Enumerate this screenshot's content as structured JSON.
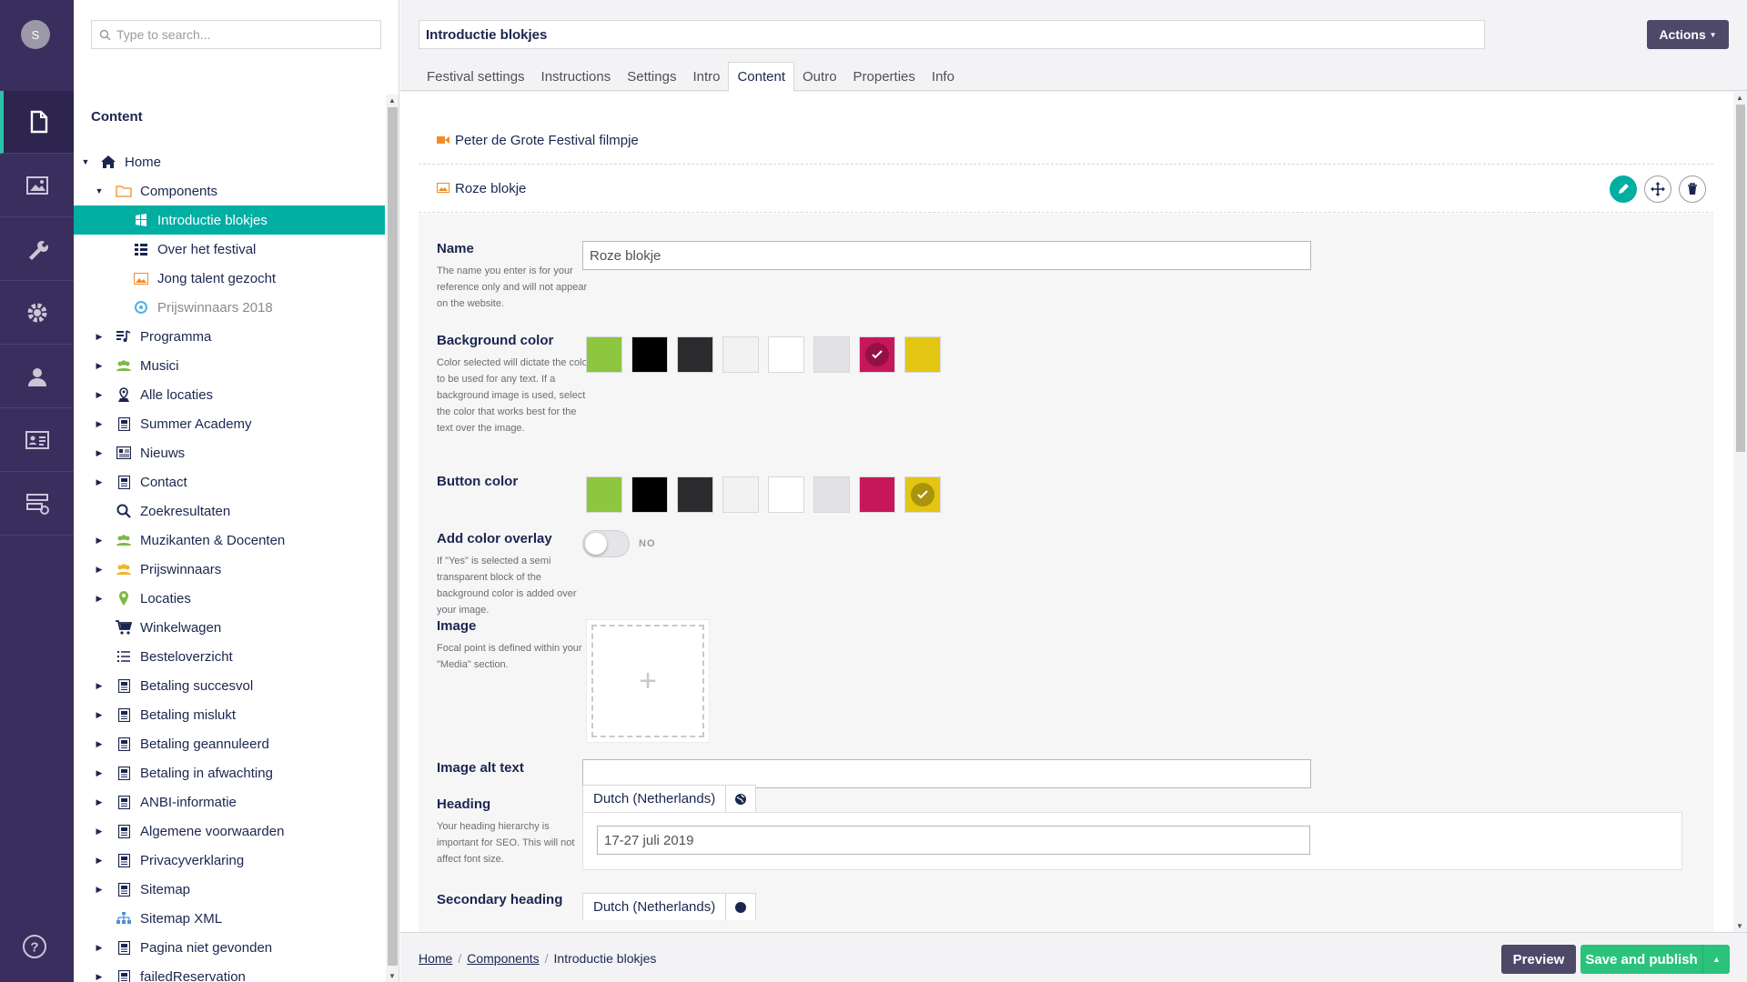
{
  "user": {
    "initial": "S"
  },
  "sections": [
    {
      "name": "content",
      "icon": "document-icon",
      "active": true
    },
    {
      "name": "media",
      "icon": "image-icon"
    },
    {
      "name": "settings",
      "icon": "wrench-icon"
    },
    {
      "name": "packages",
      "icon": "gear-icon"
    },
    {
      "name": "users",
      "icon": "user-icon"
    },
    {
      "name": "members",
      "icon": "id-card-icon"
    },
    {
      "name": "forms",
      "icon": "forms-icon"
    }
  ],
  "tree": {
    "search_placeholder": "Type to search...",
    "title": "Content",
    "items": [
      {
        "label": "Home",
        "level": 0,
        "caret": "down",
        "icon": "home-icon"
      },
      {
        "label": "Components",
        "level": 1,
        "caret": "down",
        "icon": "folder-icon"
      },
      {
        "label": "Introductie blokjes",
        "level": 2,
        "icon": "blocks-icon",
        "selected": true
      },
      {
        "label": "Over het festival",
        "level": 2,
        "icon": "grid-list-icon"
      },
      {
        "label": "Jong talent gezocht",
        "level": 2,
        "icon": "picture-icon"
      },
      {
        "label": "Prijswinnaars 2018",
        "level": 2,
        "icon": "target-icon",
        "muted": true
      },
      {
        "label": "Programma",
        "level": 1,
        "caret": "right",
        "icon": "music-list-icon"
      },
      {
        "label": "Musici",
        "level": 1,
        "caret": "right",
        "icon": "people-icon"
      },
      {
        "label": "Alle locaties",
        "level": 1,
        "caret": "right",
        "icon": "map-user-icon"
      },
      {
        "label": "Summer Academy",
        "level": 1,
        "caret": "right",
        "icon": "page-icon"
      },
      {
        "label": "Nieuws",
        "level": 1,
        "caret": "right",
        "icon": "newspaper-icon"
      },
      {
        "label": "Contact",
        "level": 1,
        "caret": "right",
        "icon": "page-icon"
      },
      {
        "label": "Zoekresultaten",
        "level": 1,
        "icon": "search-icon"
      },
      {
        "label": "Muzikanten & Docenten",
        "level": 1,
        "caret": "right",
        "icon": "people-icon"
      },
      {
        "label": "Prijswinnaars",
        "level": 1,
        "caret": "right",
        "icon": "people-gold-icon"
      },
      {
        "label": "Locaties",
        "level": 1,
        "caret": "right",
        "icon": "map-pin-icon"
      },
      {
        "label": "Winkelwagen",
        "level": 1,
        "icon": "cart-icon"
      },
      {
        "label": "Besteloverzicht",
        "level": 1,
        "icon": "list-icon"
      },
      {
        "label": "Betaling succesvol",
        "level": 1,
        "caret": "right",
        "icon": "page-icon"
      },
      {
        "label": "Betaling mislukt",
        "level": 1,
        "caret": "right",
        "icon": "page-icon"
      },
      {
        "label": "Betaling geannuleerd",
        "level": 1,
        "caret": "right",
        "icon": "page-icon"
      },
      {
        "label": "Betaling in afwachting",
        "level": 1,
        "caret": "right",
        "icon": "page-icon"
      },
      {
        "label": "ANBI-informatie",
        "level": 1,
        "caret": "right",
        "icon": "page-icon"
      },
      {
        "label": "Algemene voorwaarden",
        "level": 1,
        "caret": "right",
        "icon": "page-icon"
      },
      {
        "label": "Privacyverklaring",
        "level": 1,
        "caret": "right",
        "icon": "page-icon"
      },
      {
        "label": "Sitemap",
        "level": 1,
        "caret": "right",
        "icon": "page-icon"
      },
      {
        "label": "Sitemap XML",
        "level": 1,
        "icon": "sitemap-icon"
      },
      {
        "label": "Pagina niet gevonden",
        "level": 1,
        "caret": "right",
        "icon": "page-icon"
      },
      {
        "label": "failedReservation",
        "level": 1,
        "caret": "right",
        "icon": "page-icon"
      }
    ]
  },
  "editor": {
    "name_value": "Introductie blokjes",
    "actions_label": "Actions",
    "tabs": [
      "Festival settings",
      "Instructions",
      "Settings",
      "Intro",
      "Content",
      "Outro",
      "Properties",
      "Info"
    ],
    "active_tab": "Content",
    "blocks": [
      {
        "label": "Peter de Grote Festival filmpje",
        "icon": "video-icon"
      },
      {
        "label": "Roze blokje",
        "icon": "image-block-icon"
      }
    ],
    "fields": {
      "name": {
        "label": "Name",
        "desc": "The name you enter is for your reference only and will not appear on the website.",
        "value": "Roze blokje"
      },
      "background_color": {
        "label": "Background color",
        "desc": "Color selected will dictate the color to be used for any text. If a background image is used, select the color that works best for the text over the image.",
        "selected_index": 6
      },
      "button_color": {
        "label": "Button color",
        "selected_index": 7
      },
      "overlay": {
        "label": "Add color overlay",
        "desc": "If \"Yes\" is selected a semi transparent block of the background color is added over your image.",
        "state": "NO"
      },
      "image": {
        "label": "Image",
        "desc": "Focal point is defined within your \"Media\" section."
      },
      "image_alt": {
        "label": "Image alt text",
        "value": ""
      },
      "heading": {
        "label": "Heading",
        "desc": "Your heading hierarchy is important for SEO. This will not affect font size.",
        "language": "Dutch (Netherlands)",
        "value": "17-27 juli 2019"
      },
      "secondary_heading": {
        "label": "Secondary heading",
        "language": "Dutch (Netherlands)"
      }
    },
    "swatches": [
      "#8dc63f",
      "#000000",
      "#2b2b2d",
      "#f2f2f2",
      "#ffffff",
      "#e2e2e5",
      "#c7175b",
      "#e3c612"
    ]
  },
  "footer": {
    "breadcrumbs": [
      "Home",
      "Components",
      "Introductie blokjes"
    ],
    "preview_label": "Preview",
    "publish_label": "Save and publish"
  },
  "colors": {
    "accent": "#00aea2",
    "rail": "#3a2e5e",
    "publish": "#2bc37c",
    "button_dark": "#4e4869"
  }
}
